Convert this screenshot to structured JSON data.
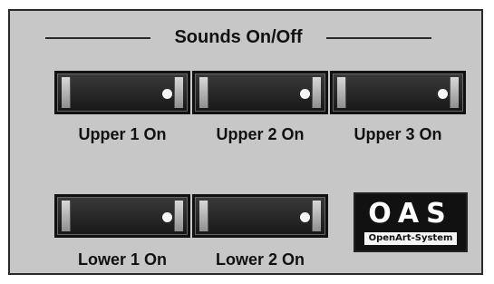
{
  "section": {
    "title": "Sounds On/Off"
  },
  "buttons": {
    "upper1": {
      "label": "Upper 1 On"
    },
    "upper2": {
      "label": "Upper 2 On"
    },
    "upper3": {
      "label": "Upper 3 On"
    },
    "lower1": {
      "label": "Lower 1 On"
    },
    "lower2": {
      "label": "Lower 2 On"
    }
  },
  "logo": {
    "mark": "OAS",
    "subtitle": "OpenArt-System"
  },
  "colors": {
    "panel_bg": "#c7c7c7",
    "toggle_bg": "#1f1f1f",
    "indicator": "#f7f7f7"
  },
  "icons": {
    "toggle_indicator": "indicator-dot-icon"
  }
}
